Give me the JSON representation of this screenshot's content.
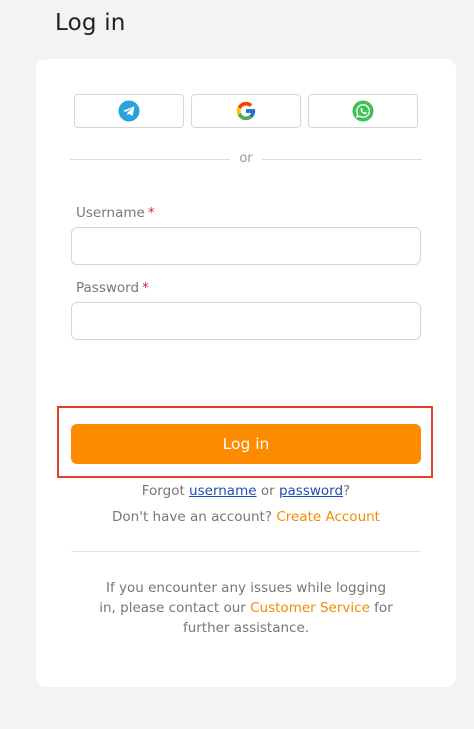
{
  "page": {
    "title": "Log in"
  },
  "social": {
    "telegram_icon": "telegram-icon",
    "google_icon": "google-icon",
    "whatsapp_icon": "whatsapp-icon"
  },
  "divider": {
    "text": "or"
  },
  "form": {
    "username_label": "Username",
    "password_label": "Password",
    "required_mark": "*",
    "username_value": "",
    "password_value": ""
  },
  "login_button": {
    "label": "Log in"
  },
  "forgot": {
    "prefix": "Forgot ",
    "username_link": "username",
    "middle": " or ",
    "password_link": "password",
    "suffix": "?"
  },
  "signup": {
    "prefix": "Don't have an account? ",
    "link": "Create Account"
  },
  "help": {
    "prefix": "If you encounter any issues while logging in, please contact our ",
    "link": "Customer Service",
    "suffix": " for further assistance."
  },
  "colors": {
    "accent": "#fd8b00",
    "link_blue": "#1f4fb2",
    "required": "#d9262e",
    "highlight": "#e0432a"
  }
}
